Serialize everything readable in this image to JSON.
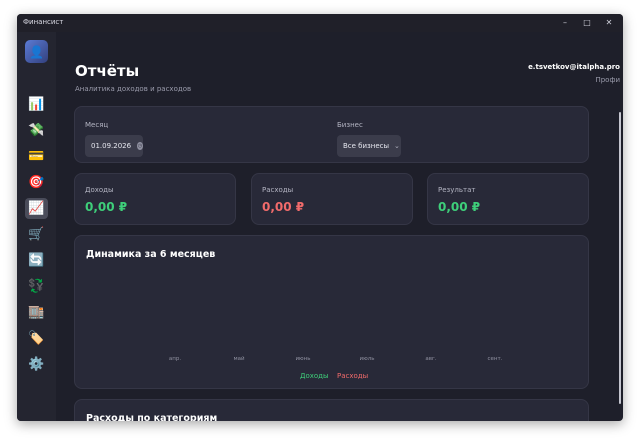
{
  "app": {
    "title": "Финансист"
  },
  "window_controls": {
    "minimize": "–",
    "maximize": "□",
    "close": "✕"
  },
  "sidebar": {
    "avatar_icon": "👤",
    "items": [
      {
        "name": "sidebar-item-dashboard",
        "icon": "📊"
      },
      {
        "name": "sidebar-item-transactions",
        "icon": "💸"
      },
      {
        "name": "sidebar-item-cards",
        "icon": "💳"
      },
      {
        "name": "sidebar-item-goals",
        "icon": "🎯"
      },
      {
        "name": "sidebar-item-reports",
        "icon": "📈",
        "active": true
      },
      {
        "name": "sidebar-item-purchases",
        "icon": "🛒"
      },
      {
        "name": "sidebar-item-sync",
        "icon": "🔄"
      },
      {
        "name": "sidebar-item-currency",
        "icon": "💱"
      },
      {
        "name": "sidebar-item-business",
        "icon": "🏬"
      },
      {
        "name": "sidebar-item-tags",
        "icon": "🏷️"
      },
      {
        "name": "sidebar-item-settings",
        "icon": "⚙️"
      }
    ]
  },
  "header": {
    "title": "Отчёты",
    "subtitle": "Аналитика доходов и расходов",
    "user_email": "e.tsvetkov@italpha.pro",
    "user_plan": "Профи"
  },
  "filters": {
    "month_label": "Месяц",
    "month_value": "01.09.2026",
    "business_label": "Бизнес",
    "business_value": "Все бизнесы"
  },
  "summary": {
    "income_label": "Доходы",
    "income_value": "0,00 ₽",
    "expenses_label": "Расходы",
    "expenses_value": "0,00 ₽",
    "result_label": "Результат",
    "result_value": "0,00 ₽"
  },
  "colors": {
    "income": "#3ecf7a",
    "expenses": "#f26b6b",
    "result": "#3ecf7a"
  },
  "chart_data": {
    "type": "bar",
    "title": "Динамика за 6 месяцев",
    "categories": [
      "апр.",
      "май",
      "июнь",
      "июль",
      "авг.",
      "сент."
    ],
    "series": [
      {
        "name": "Доходы",
        "color": "#3ecf7a",
        "values": [
          0,
          0,
          0,
          0,
          0,
          0
        ]
      },
      {
        "name": "Расходы",
        "color": "#f26b6b",
        "values": [
          0,
          0,
          0,
          0,
          0,
          0
        ]
      }
    ],
    "legend": "bottom-center",
    "grid": false
  },
  "categories_section": {
    "title": "Расходы по категориям"
  }
}
